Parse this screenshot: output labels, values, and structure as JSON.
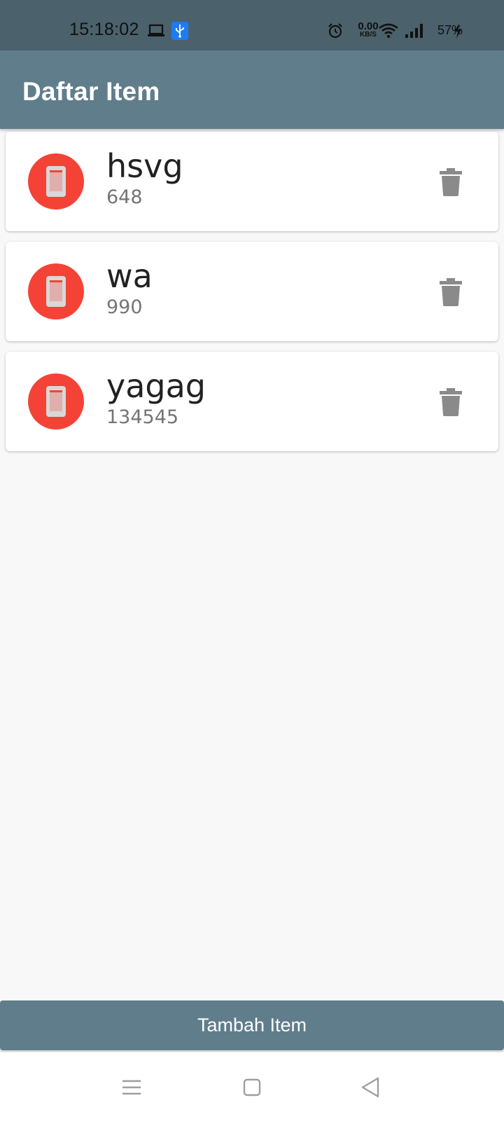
{
  "status_bar": {
    "time": "15:18:02",
    "speed_value": "0.00",
    "speed_unit": "KB/S",
    "battery": "57%",
    "icons": [
      "laptop-icon",
      "usb-icon",
      "alarm-icon",
      "wifi-icon",
      "signal-icon",
      "charging-icon"
    ]
  },
  "app_bar": {
    "title": "Daftar Item",
    "color": "#607d8b"
  },
  "items": [
    {
      "name": "hsvg",
      "value": "648",
      "icon": "phone-icon",
      "delete_icon": "trash-icon"
    },
    {
      "name": "wa",
      "value": "990",
      "icon": "phone-icon",
      "delete_icon": "trash-icon"
    },
    {
      "name": "yagag",
      "value": "134545",
      "icon": "phone-icon",
      "delete_icon": "trash-icon"
    }
  ],
  "add_button": {
    "label": "Tambah Item"
  },
  "nav_bar": {
    "buttons": [
      "menu-icon",
      "home-icon",
      "back-icon"
    ]
  },
  "colors": {
    "avatar": "#f44336",
    "primary": "#607d8b",
    "status_bar": "#4b616c"
  }
}
